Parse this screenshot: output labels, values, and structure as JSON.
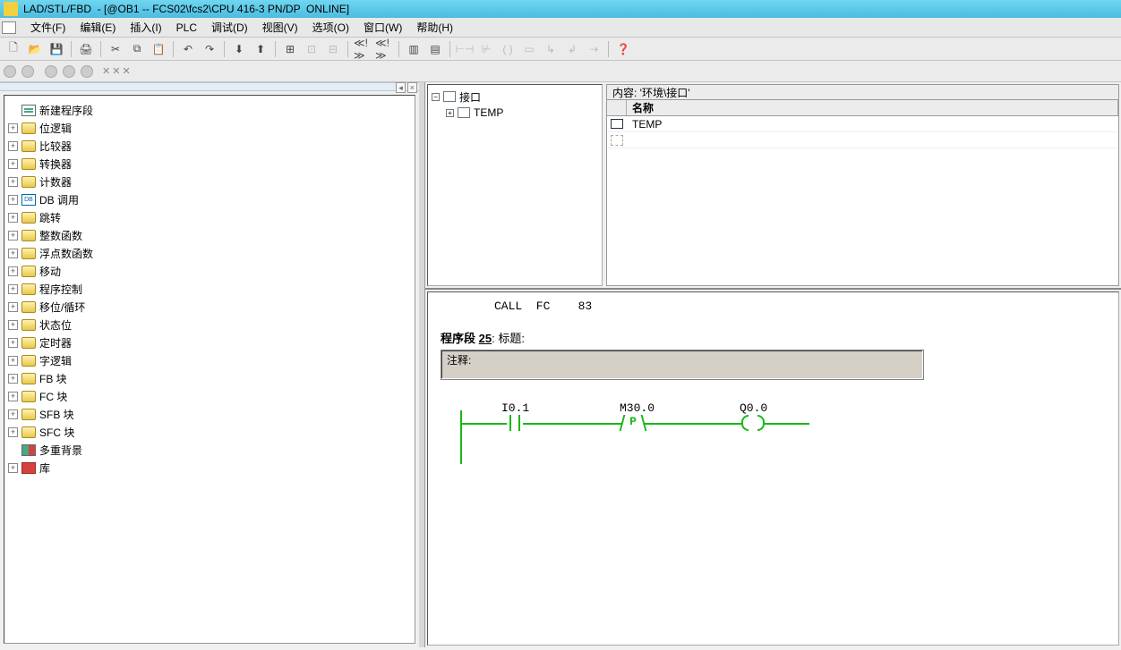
{
  "title": "LAD/STL/FBD  - [@OB1 -- FCS02\\fcs2\\CPU 416-3 PN/DP  ONLINE]",
  "menu": {
    "file": "文件(F)",
    "edit": "编辑(E)",
    "insert": "插入(I)",
    "plc": "PLC",
    "debug": "调试(D)",
    "view": "视图(V)",
    "options": "选项(O)",
    "window": "窗口(W)",
    "help": "帮助(H)"
  },
  "tree": {
    "root_label": "新建程序段",
    "items": [
      "位逻辑",
      "比较器",
      "转换器",
      "计数器",
      "DB 调用",
      "跳转",
      "整数函数",
      "浮点数函数",
      "移动",
      "程序控制",
      "移位/循环",
      "状态位",
      "定时器",
      "字逻辑",
      "FB 块",
      "FC 块",
      "SFB 块",
      "SFC 块",
      "多重背景",
      "库"
    ]
  },
  "interface_panel": {
    "caption": "内容:  '环境\\接口'",
    "col_name": "名称",
    "root": "接口",
    "temp": "TEMP",
    "row_temp": "TEMP"
  },
  "editor": {
    "stl_call": "CALL  FC    83",
    "network_label": "程序段",
    "network_number": "25",
    "network_title_prefix": ": 标题:",
    "comment_label": "注释:",
    "addr_i": "I0.1",
    "addr_m": "M30.0",
    "addr_q": "Q0.0",
    "p_symbol": "P"
  }
}
